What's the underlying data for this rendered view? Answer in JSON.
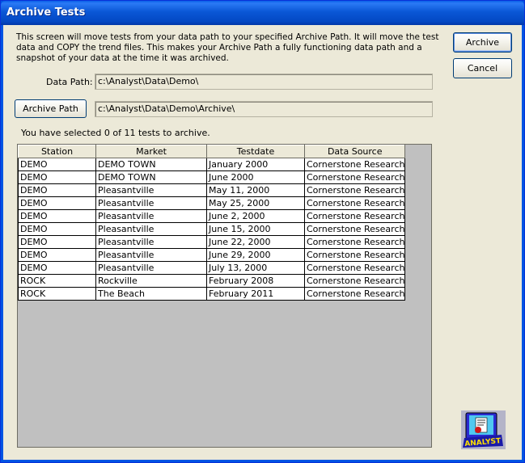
{
  "window": {
    "title": "Archive Tests"
  },
  "description": "This screen will move tests from your data path to your specified Archive Path.  It will move the test data and COPY the trend files.  This makes your Archive Path a fully functioning data path and a snapshot of your data at the time it was archived.",
  "buttons": {
    "archive": "Archive",
    "cancel": "Cancel",
    "archive_path": "Archive Path"
  },
  "data_path": {
    "label": "Data Path:",
    "value": "c:\\Analyst\\Data\\Demo\\"
  },
  "archive_path": {
    "value": "c:\\Analyst\\Data\\Demo\\Archive\\"
  },
  "status": "You have selected 0 of 11 tests to archive.",
  "table": {
    "columns": [
      "Station",
      "Market",
      "Testdate",
      "Data Source"
    ],
    "rows": [
      [
        "DEMO",
        "DEMO TOWN",
        "January 2000",
        "Cornerstone Research"
      ],
      [
        "DEMO",
        "DEMO TOWN",
        "June 2000",
        "Cornerstone Research"
      ],
      [
        "DEMO",
        "Pleasantville",
        "May 11, 2000",
        "Cornerstone Research"
      ],
      [
        "DEMO",
        "Pleasantville",
        "May 25, 2000",
        "Cornerstone Research"
      ],
      [
        "DEMO",
        "Pleasantville",
        "June 2, 2000",
        "Cornerstone Research"
      ],
      [
        "DEMO",
        "Pleasantville",
        "June 15, 2000",
        "Cornerstone Research"
      ],
      [
        "DEMO",
        "Pleasantville",
        "June 22, 2000",
        "Cornerstone Research"
      ],
      [
        "DEMO",
        "Pleasantville",
        "June 29, 2000",
        "Cornerstone Research"
      ],
      [
        "DEMO",
        "Pleasantville",
        "July 13, 2000",
        "Cornerstone Research"
      ],
      [
        "ROCK",
        "Rockville",
        "February 2008",
        "Cornerstone Research"
      ],
      [
        "ROCK",
        "The Beach",
        "February 2011",
        "Cornerstone Research"
      ]
    ]
  },
  "logo": {
    "text": "ANALYST",
    "icon": "analyst-monitor-icon"
  },
  "colors": {
    "title_bar": "#0054e3",
    "face": "#ece9d8",
    "grid_empty": "#c0c0c0",
    "button_border": "#003c74"
  }
}
